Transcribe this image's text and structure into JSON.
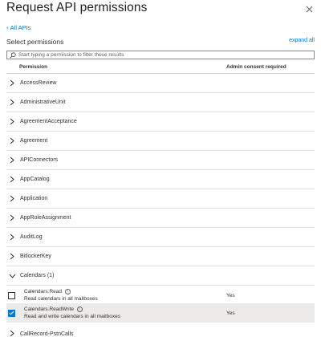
{
  "header": {
    "title": "Request API permissions"
  },
  "nav": {
    "back_label": "All APIs"
  },
  "select": {
    "label": "Select permissions",
    "expand_all": "expand all"
  },
  "search": {
    "placeholder": "Start typing a permission to filter these results"
  },
  "columns": {
    "permission": "Permission",
    "admin_consent": "Admin consent required"
  },
  "groups": [
    {
      "label": "AccessReview"
    },
    {
      "label": "AdministrativeUnit"
    },
    {
      "label": "AgreementAcceptance"
    },
    {
      "label": "Agreement"
    },
    {
      "label": "APIConnectors"
    },
    {
      "label": "AppCatalog"
    },
    {
      "label": "Application"
    },
    {
      "label": "AppRoleAssignment"
    },
    {
      "label": "AuditLog"
    },
    {
      "label": "BitlockerKey"
    }
  ],
  "calendars": {
    "label": "Calendars (1)",
    "permissions": [
      {
        "name": "Calendars.Read",
        "description": "Read calendars in all mailboxes",
        "admin": "Yes",
        "checked": false
      },
      {
        "name": "Calendars.ReadWrite",
        "description": "Read and write calendars in all mailboxes",
        "admin": "Yes",
        "checked": true
      }
    ]
  },
  "next_group": {
    "label": "CallRecord-PstnCalls"
  },
  "colors": {
    "accent": "#0078d4",
    "selected_row": "#edebe9",
    "border": "#e1dfdd"
  },
  "icons": {
    "close": "close-icon",
    "search": "search-icon",
    "chevron": "chevron-right-icon",
    "info": "info-icon",
    "check": "checkmark-icon"
  }
}
